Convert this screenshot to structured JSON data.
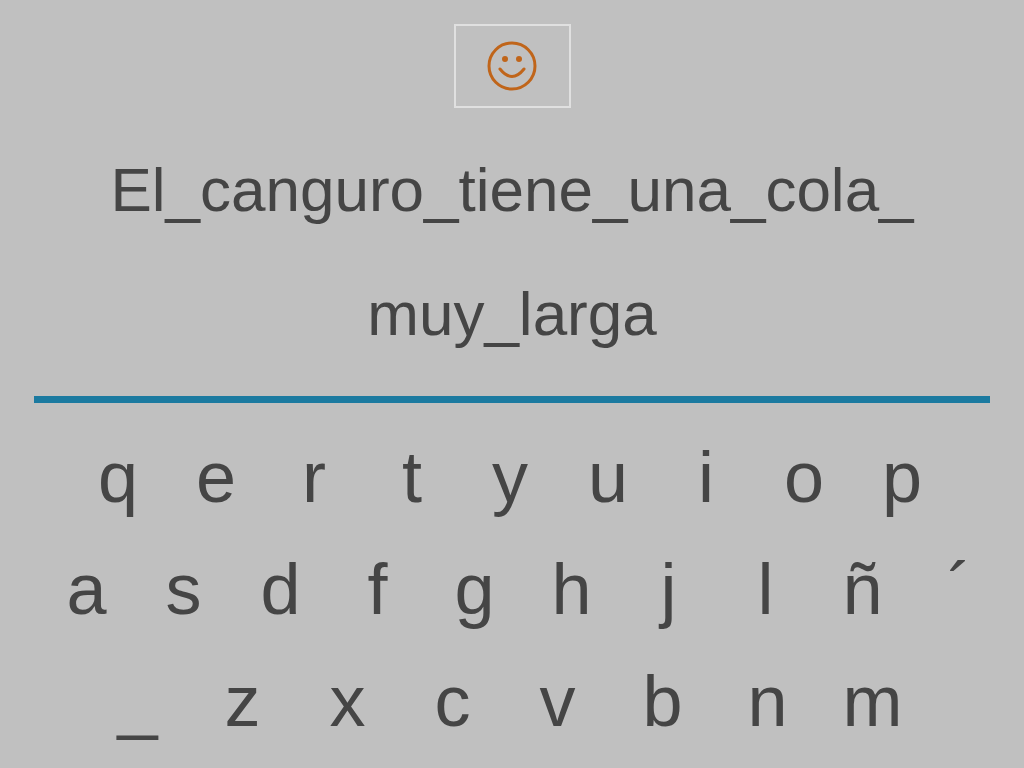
{
  "feedback_box": {
    "kind": "smiley"
  },
  "sentence": {
    "lines": [
      "El_canguro_tiene_una_cola_",
      "muy_larga"
    ]
  },
  "keyboard": {
    "rows": [
      [
        "q",
        "e",
        "r",
        "t",
        "y",
        "u",
        "i",
        "o",
        "p"
      ],
      [
        "a",
        "s",
        "d",
        "f",
        "g",
        "h",
        "j",
        "l",
        "ñ",
        "´"
      ],
      [
        "_",
        "z",
        "x",
        "c",
        "v",
        "b",
        "n",
        "m"
      ]
    ]
  }
}
